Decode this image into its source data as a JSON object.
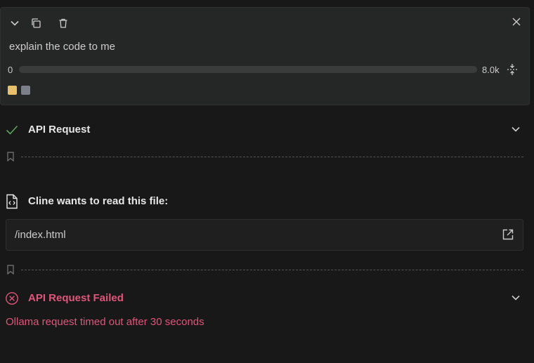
{
  "task": {
    "text": "explain the code to me",
    "context_window": {
      "start_label": "0",
      "max_label": "8.0k",
      "used_fraction": 0.0
    },
    "swatch_colors": [
      "#e8c06c",
      "#7c7f87"
    ]
  },
  "api_request": {
    "title": "API Request",
    "status_color": "#58a65c"
  },
  "read_file": {
    "title": "Cline wants to read this file:",
    "path": "/index.html"
  },
  "api_failed": {
    "title": "API Request Failed",
    "message": "Ollama request timed out after 30 seconds",
    "color": "#e0557a"
  },
  "icons": {
    "collapse": "chevron-down-icon",
    "copy": "copy-icon",
    "delete": "trash-icon",
    "close": "close-icon",
    "compress": "compress-icon",
    "success": "check-icon",
    "file": "file-code-icon",
    "open_external": "external-link-icon",
    "bookmark": "bookmark-icon",
    "error": "error-circle-icon"
  }
}
